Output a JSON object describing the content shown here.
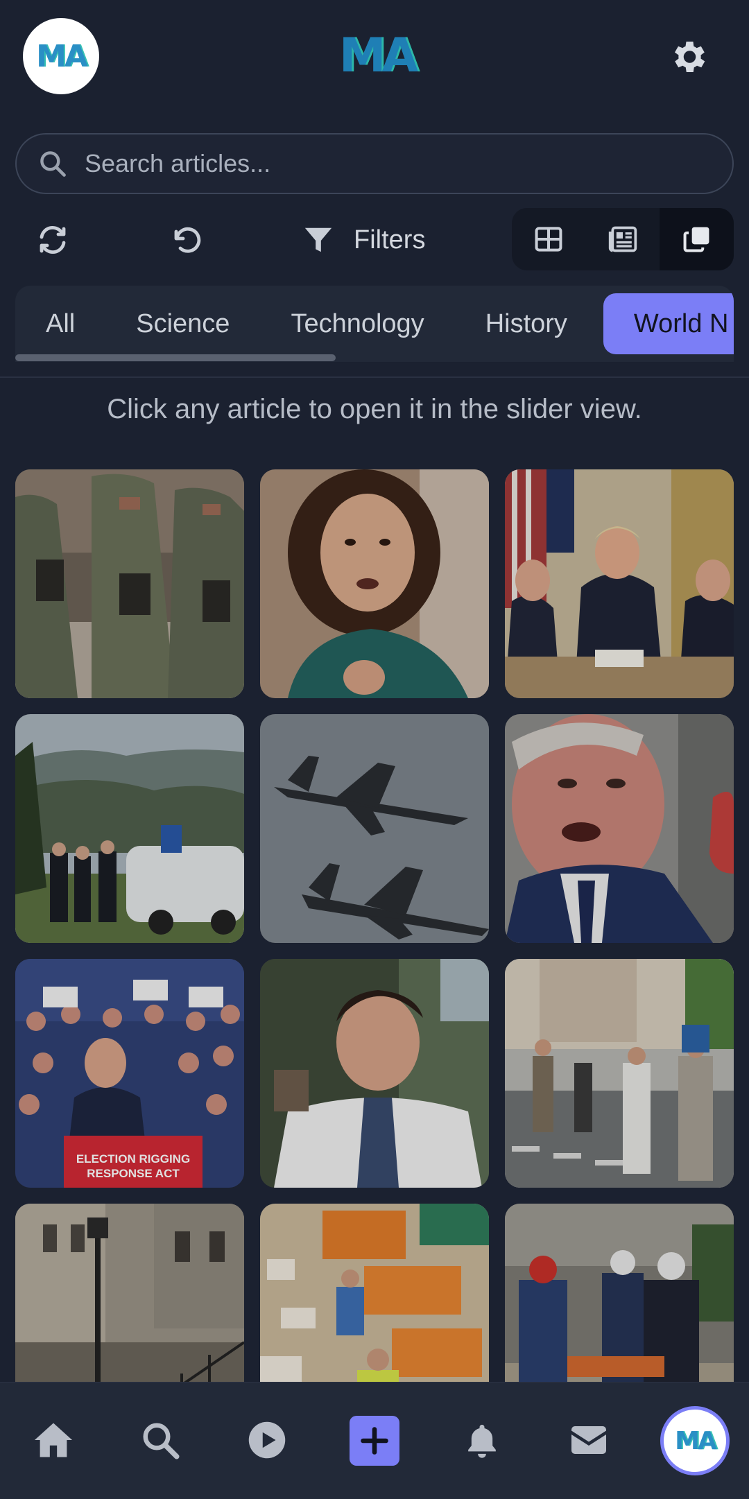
{
  "header": {
    "logo_text": "MA",
    "avatar_text": "MA"
  },
  "search": {
    "placeholder": "Search articles..."
  },
  "toolbar": {
    "filters_label": "Filters",
    "view_modes": [
      "grid-icon",
      "list-icon",
      "slider-icon"
    ],
    "active_view": "slider-icon"
  },
  "categories": {
    "items": [
      "All",
      "Science",
      "Technology",
      "History",
      "World N"
    ],
    "selected": "World N"
  },
  "hint": "Click any article to open it in the slider view.",
  "articles": [
    {
      "image": "soldiers-in-camouflage-photo"
    },
    {
      "image": "young-man-speaking-to-camera-photo"
    },
    {
      "image": "press-conference-at-table-photo"
    },
    {
      "image": "police-by-white-car-in-mountains-photo"
    },
    {
      "image": "two-fighter-jets-photo"
    },
    {
      "image": "politician-closeup-photo"
    },
    {
      "image": "rally-speaker-at-podium-photo",
      "caption": "ELECTION RIGGING RESPONSE ACT"
    },
    {
      "image": "man-in-shirt-and-tie-photo"
    },
    {
      "image": "people-crossing-street-photo"
    },
    {
      "image": "old-stone-street-with-lamp-photo"
    },
    {
      "image": "workers-sorting-parcels-photo"
    },
    {
      "image": "rescue-workers-carrying-stretcher-photo"
    }
  ],
  "nav": [
    "home-icon",
    "search-icon",
    "play-icon",
    "add-icon",
    "bell-icon",
    "mail-icon",
    "profile-avatar"
  ],
  "colors": {
    "background": "#1b2130",
    "accent": "#7b7ef6",
    "surface": "#222938"
  }
}
